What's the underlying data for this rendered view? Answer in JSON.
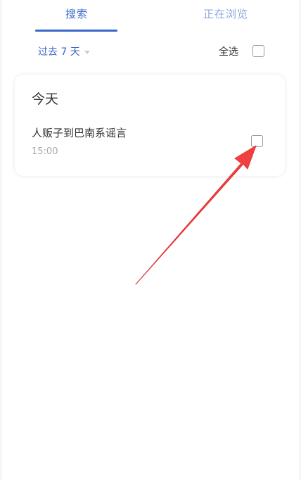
{
  "tabs": {
    "search_label": "搜索",
    "browsing_label": "正在浏览"
  },
  "filter": {
    "range_label": "过去 7 天",
    "select_all_label": "全选"
  },
  "history": {
    "section_title": "今天",
    "items": [
      {
        "title": "人贩子到巴南系谣言",
        "time": "15:00"
      }
    ]
  },
  "colors": {
    "accent": "#3a68c8",
    "annotation_arrow": "#f04040"
  }
}
